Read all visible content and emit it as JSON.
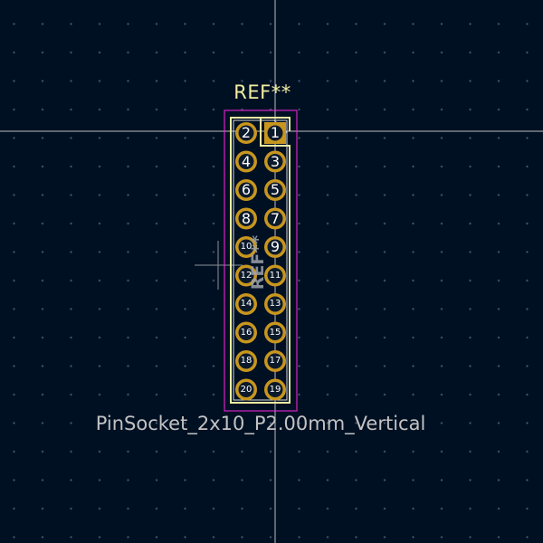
{
  "footprint": {
    "reference": "REF**",
    "reference_rotated": "REF**",
    "value": "PinSocket_2x10_P2.00mm_Vertical"
  },
  "colors": {
    "background": "#001023",
    "pad": "#c8961e",
    "pad_hole": "#0b1a2b",
    "silkscreen": "#f2eda1",
    "courtyard": "#ff26e2",
    "crosshair": "#dcdcdc"
  },
  "pads": [
    {
      "number": "1",
      "shape": "square"
    },
    {
      "number": "2",
      "shape": "circle"
    },
    {
      "number": "3",
      "shape": "circle"
    },
    {
      "number": "4",
      "shape": "circle"
    },
    {
      "number": "5",
      "shape": "circle"
    },
    {
      "number": "6",
      "shape": "circle"
    },
    {
      "number": "7",
      "shape": "circle"
    },
    {
      "number": "8",
      "shape": "circle"
    },
    {
      "number": "9",
      "shape": "circle"
    },
    {
      "number": "10",
      "shape": "circle"
    },
    {
      "number": "11",
      "shape": "circle"
    },
    {
      "number": "12",
      "shape": "circle"
    },
    {
      "number": "13",
      "shape": "circle"
    },
    {
      "number": "14",
      "shape": "circle"
    },
    {
      "number": "15",
      "shape": "circle"
    },
    {
      "number": "16",
      "shape": "circle"
    },
    {
      "number": "17",
      "shape": "circle"
    },
    {
      "number": "18",
      "shape": "circle"
    },
    {
      "number": "19",
      "shape": "circle"
    },
    {
      "number": "20",
      "shape": "circle"
    }
  ]
}
